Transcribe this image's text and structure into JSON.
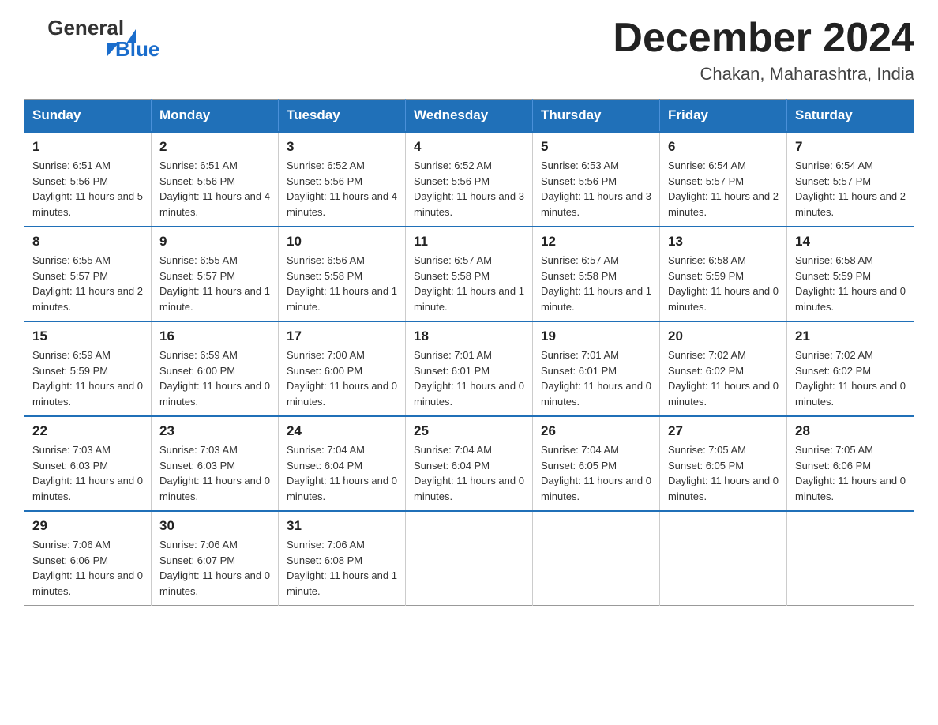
{
  "logo": {
    "general": "General",
    "blue": "Blue"
  },
  "title": "December 2024",
  "location": "Chakan, Maharashtra, India",
  "days_header": [
    "Sunday",
    "Monday",
    "Tuesday",
    "Wednesday",
    "Thursday",
    "Friday",
    "Saturday"
  ],
  "weeks": [
    [
      {
        "day": "1",
        "sunrise": "6:51 AM",
        "sunset": "5:56 PM",
        "daylight": "11 hours and 5 minutes."
      },
      {
        "day": "2",
        "sunrise": "6:51 AM",
        "sunset": "5:56 PM",
        "daylight": "11 hours and 4 minutes."
      },
      {
        "day": "3",
        "sunrise": "6:52 AM",
        "sunset": "5:56 PM",
        "daylight": "11 hours and 4 minutes."
      },
      {
        "day": "4",
        "sunrise": "6:52 AM",
        "sunset": "5:56 PM",
        "daylight": "11 hours and 3 minutes."
      },
      {
        "day": "5",
        "sunrise": "6:53 AM",
        "sunset": "5:56 PM",
        "daylight": "11 hours and 3 minutes."
      },
      {
        "day": "6",
        "sunrise": "6:54 AM",
        "sunset": "5:57 PM",
        "daylight": "11 hours and 2 minutes."
      },
      {
        "day": "7",
        "sunrise": "6:54 AM",
        "sunset": "5:57 PM",
        "daylight": "11 hours and 2 minutes."
      }
    ],
    [
      {
        "day": "8",
        "sunrise": "6:55 AM",
        "sunset": "5:57 PM",
        "daylight": "11 hours and 2 minutes."
      },
      {
        "day": "9",
        "sunrise": "6:55 AM",
        "sunset": "5:57 PM",
        "daylight": "11 hours and 1 minute."
      },
      {
        "day": "10",
        "sunrise": "6:56 AM",
        "sunset": "5:58 PM",
        "daylight": "11 hours and 1 minute."
      },
      {
        "day": "11",
        "sunrise": "6:57 AM",
        "sunset": "5:58 PM",
        "daylight": "11 hours and 1 minute."
      },
      {
        "day": "12",
        "sunrise": "6:57 AM",
        "sunset": "5:58 PM",
        "daylight": "11 hours and 1 minute."
      },
      {
        "day": "13",
        "sunrise": "6:58 AM",
        "sunset": "5:59 PM",
        "daylight": "11 hours and 0 minutes."
      },
      {
        "day": "14",
        "sunrise": "6:58 AM",
        "sunset": "5:59 PM",
        "daylight": "11 hours and 0 minutes."
      }
    ],
    [
      {
        "day": "15",
        "sunrise": "6:59 AM",
        "sunset": "5:59 PM",
        "daylight": "11 hours and 0 minutes."
      },
      {
        "day": "16",
        "sunrise": "6:59 AM",
        "sunset": "6:00 PM",
        "daylight": "11 hours and 0 minutes."
      },
      {
        "day": "17",
        "sunrise": "7:00 AM",
        "sunset": "6:00 PM",
        "daylight": "11 hours and 0 minutes."
      },
      {
        "day": "18",
        "sunrise": "7:01 AM",
        "sunset": "6:01 PM",
        "daylight": "11 hours and 0 minutes."
      },
      {
        "day": "19",
        "sunrise": "7:01 AM",
        "sunset": "6:01 PM",
        "daylight": "11 hours and 0 minutes."
      },
      {
        "day": "20",
        "sunrise": "7:02 AM",
        "sunset": "6:02 PM",
        "daylight": "11 hours and 0 minutes."
      },
      {
        "day": "21",
        "sunrise": "7:02 AM",
        "sunset": "6:02 PM",
        "daylight": "11 hours and 0 minutes."
      }
    ],
    [
      {
        "day": "22",
        "sunrise": "7:03 AM",
        "sunset": "6:03 PM",
        "daylight": "11 hours and 0 minutes."
      },
      {
        "day": "23",
        "sunrise": "7:03 AM",
        "sunset": "6:03 PM",
        "daylight": "11 hours and 0 minutes."
      },
      {
        "day": "24",
        "sunrise": "7:04 AM",
        "sunset": "6:04 PM",
        "daylight": "11 hours and 0 minutes."
      },
      {
        "day": "25",
        "sunrise": "7:04 AM",
        "sunset": "6:04 PM",
        "daylight": "11 hours and 0 minutes."
      },
      {
        "day": "26",
        "sunrise": "7:04 AM",
        "sunset": "6:05 PM",
        "daylight": "11 hours and 0 minutes."
      },
      {
        "day": "27",
        "sunrise": "7:05 AM",
        "sunset": "6:05 PM",
        "daylight": "11 hours and 0 minutes."
      },
      {
        "day": "28",
        "sunrise": "7:05 AM",
        "sunset": "6:06 PM",
        "daylight": "11 hours and 0 minutes."
      }
    ],
    [
      {
        "day": "29",
        "sunrise": "7:06 AM",
        "sunset": "6:06 PM",
        "daylight": "11 hours and 0 minutes."
      },
      {
        "day": "30",
        "sunrise": "7:06 AM",
        "sunset": "6:07 PM",
        "daylight": "11 hours and 0 minutes."
      },
      {
        "day": "31",
        "sunrise": "7:06 AM",
        "sunset": "6:08 PM",
        "daylight": "11 hours and 1 minute."
      },
      null,
      null,
      null,
      null
    ]
  ]
}
